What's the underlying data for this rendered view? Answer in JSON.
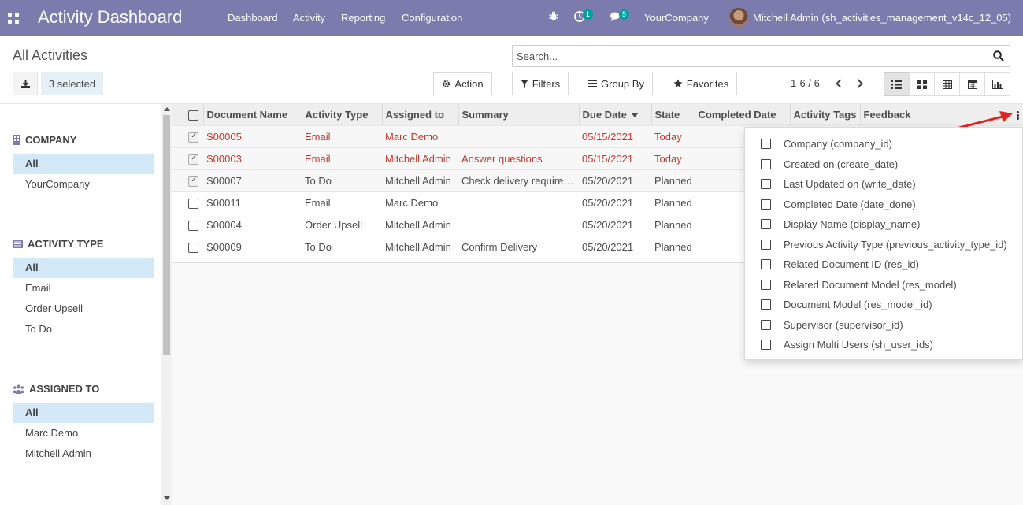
{
  "navbar": {
    "brand": "Activity Dashboard",
    "menu": [
      "Dashboard",
      "Activity",
      "Reporting",
      "Configuration"
    ],
    "activity_count": "1",
    "message_count": "5",
    "company": "YourCompany",
    "user": "Mitchell Admin (sh_activities_management_v14c_12_05)"
  },
  "control_panel": {
    "title": "All Activities",
    "selected": "3 selected",
    "search_placeholder": "Search...",
    "action": "Action",
    "filters": "Filters",
    "group_by": "Group By",
    "favorites": "Favorites",
    "pager": "1-6 / 6"
  },
  "sidebar": {
    "company": {
      "title": "COMPANY",
      "items": [
        "All",
        "YourCompany"
      ]
    },
    "activity_type": {
      "title": "ACTIVITY TYPE",
      "items": [
        "All",
        "Email",
        "Order Upsell",
        "To Do"
      ]
    },
    "assigned_to": {
      "title": "ASSIGNED TO",
      "items": [
        "All",
        "Marc Demo",
        "Mitchell Admin"
      ]
    }
  },
  "table": {
    "columns": [
      "Document Name",
      "Activity Type",
      "Assigned to",
      "Summary",
      "Due Date",
      "State",
      "Completed Date",
      "Activity Tags",
      "Feedback"
    ],
    "rows": [
      {
        "doc": "S00005",
        "type": "Email",
        "assigned": "Marc Demo",
        "summary": "",
        "due": "05/15/2021",
        "state": "Today",
        "checked": true,
        "overdue": true
      },
      {
        "doc": "S00003",
        "type": "Email",
        "assigned": "Mitchell Admin",
        "summary": "Answer questions",
        "due": "05/15/2021",
        "state": "Today",
        "checked": true,
        "overdue": true
      },
      {
        "doc": "S00007",
        "type": "To Do",
        "assigned": "Mitchell Admin",
        "summary": "Check delivery requirements",
        "due": "05/20/2021",
        "state": "Planned",
        "checked": true,
        "overdue": false
      },
      {
        "doc": "S00011",
        "type": "Email",
        "assigned": "Marc Demo",
        "summary": "",
        "due": "05/20/2021",
        "state": "Planned",
        "checked": false,
        "overdue": false
      },
      {
        "doc": "S00004",
        "type": "Order Upsell",
        "assigned": "Mitchell Admin",
        "summary": "",
        "due": "05/20/2021",
        "state": "Planned",
        "checked": false,
        "overdue": false
      },
      {
        "doc": "S00009",
        "type": "To Do",
        "assigned": "Mitchell Admin",
        "summary": "Confirm Delivery",
        "due": "05/20/2021",
        "state": "Planned",
        "checked": false,
        "overdue": false
      }
    ]
  },
  "optional_columns": [
    "Company (company_id)",
    "Created on (create_date)",
    "Last Updated on (write_date)",
    "Completed Date (date_done)",
    "Display Name (display_name)",
    "Previous Activity Type (previous_activity_type_id)",
    "Related Document ID (res_id)",
    "Related Document Model (res_model)",
    "Document Model (res_model_id)",
    "Supervisor (supervisor_id)",
    "Assign Multi Users (sh_user_ids)"
  ],
  "colors": {
    "navbar": "#7c7bad",
    "overdue": "#c0392b",
    "badge": "#00a09d",
    "arrow": "#e32222",
    "sidebar_active": "#d4e9f7"
  }
}
